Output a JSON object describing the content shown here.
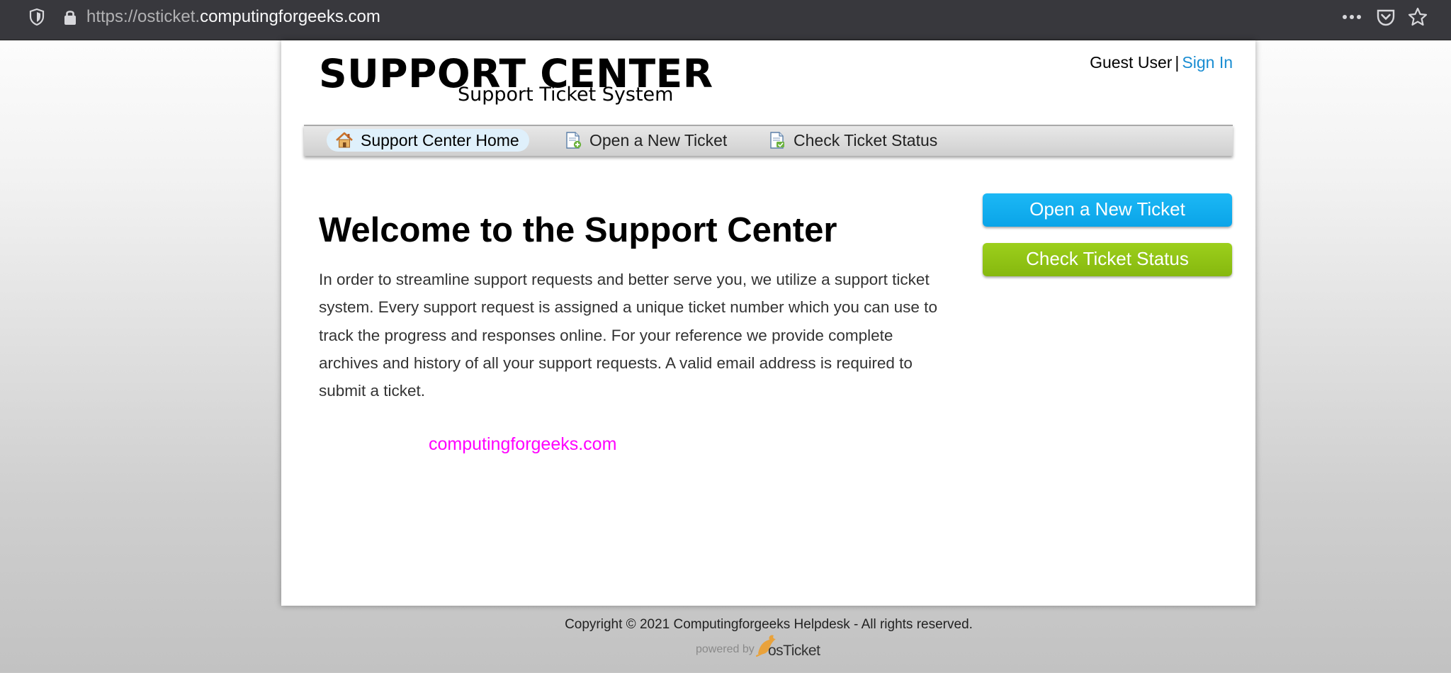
{
  "browser": {
    "url_prefix": "https://osticket.",
    "url_domain": "computingforgeeks.com"
  },
  "header": {
    "title": "SUPPORT CENTER",
    "subtitle": "Support Ticket System",
    "guest_label": "Guest User",
    "separator": "|",
    "signin_label": "Sign In"
  },
  "nav": {
    "items": [
      {
        "label": "Support Center Home",
        "icon": "home-icon",
        "active": true
      },
      {
        "label": "Open a New Ticket",
        "icon": "new-ticket-icon",
        "active": false
      },
      {
        "label": "Check Ticket Status",
        "icon": "ticket-status-icon",
        "active": false
      }
    ]
  },
  "main": {
    "title": "Welcome to the Support Center",
    "intro": "In order to streamline support requests and better serve you, we utilize a support ticket system. Every support request is assigned a unique ticket number which you can use to track the progress and responses online. For your reference we provide complete archives and history of all your support requests. A valid email address is required to submit a ticket.",
    "link_text": "computingforgeeks.com"
  },
  "sidebar": {
    "open_ticket_label": "Open a New Ticket",
    "check_status_label": "Check Ticket Status"
  },
  "footer": {
    "copyright": "Copyright © 2021 Computingforgeeks Helpdesk - All rights reserved.",
    "powered_by": "powered by",
    "brand": "osTicket"
  },
  "colors": {
    "link_blue": "#1a8dd2",
    "button_blue": "#0aa4e8",
    "button_green": "#86b80e",
    "magenta_link": "#ff00ff",
    "browser_bar": "#38383d"
  }
}
